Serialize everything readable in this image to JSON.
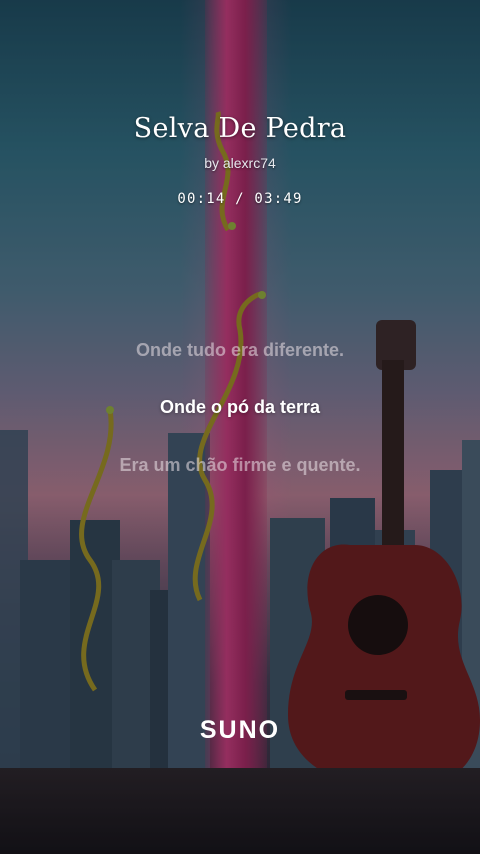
{
  "song": {
    "title": "Selva De Pedra",
    "artist_line": "by alexrc74",
    "time": "00:14 / 03:49"
  },
  "lyrics": {
    "previous": "Onde tudo era diferente.",
    "current": "Onde o pó da terra",
    "next": "Era um chão firme e quente."
  },
  "brand": {
    "logo_text": "SUNO"
  },
  "colors": {
    "accent_beam": "#c23a78",
    "lyric_active": "#ffffff",
    "lyric_inactive": "#e6dce6"
  },
  "icons": {
    "background_art": "cityscape-guitar-vines-art"
  }
}
